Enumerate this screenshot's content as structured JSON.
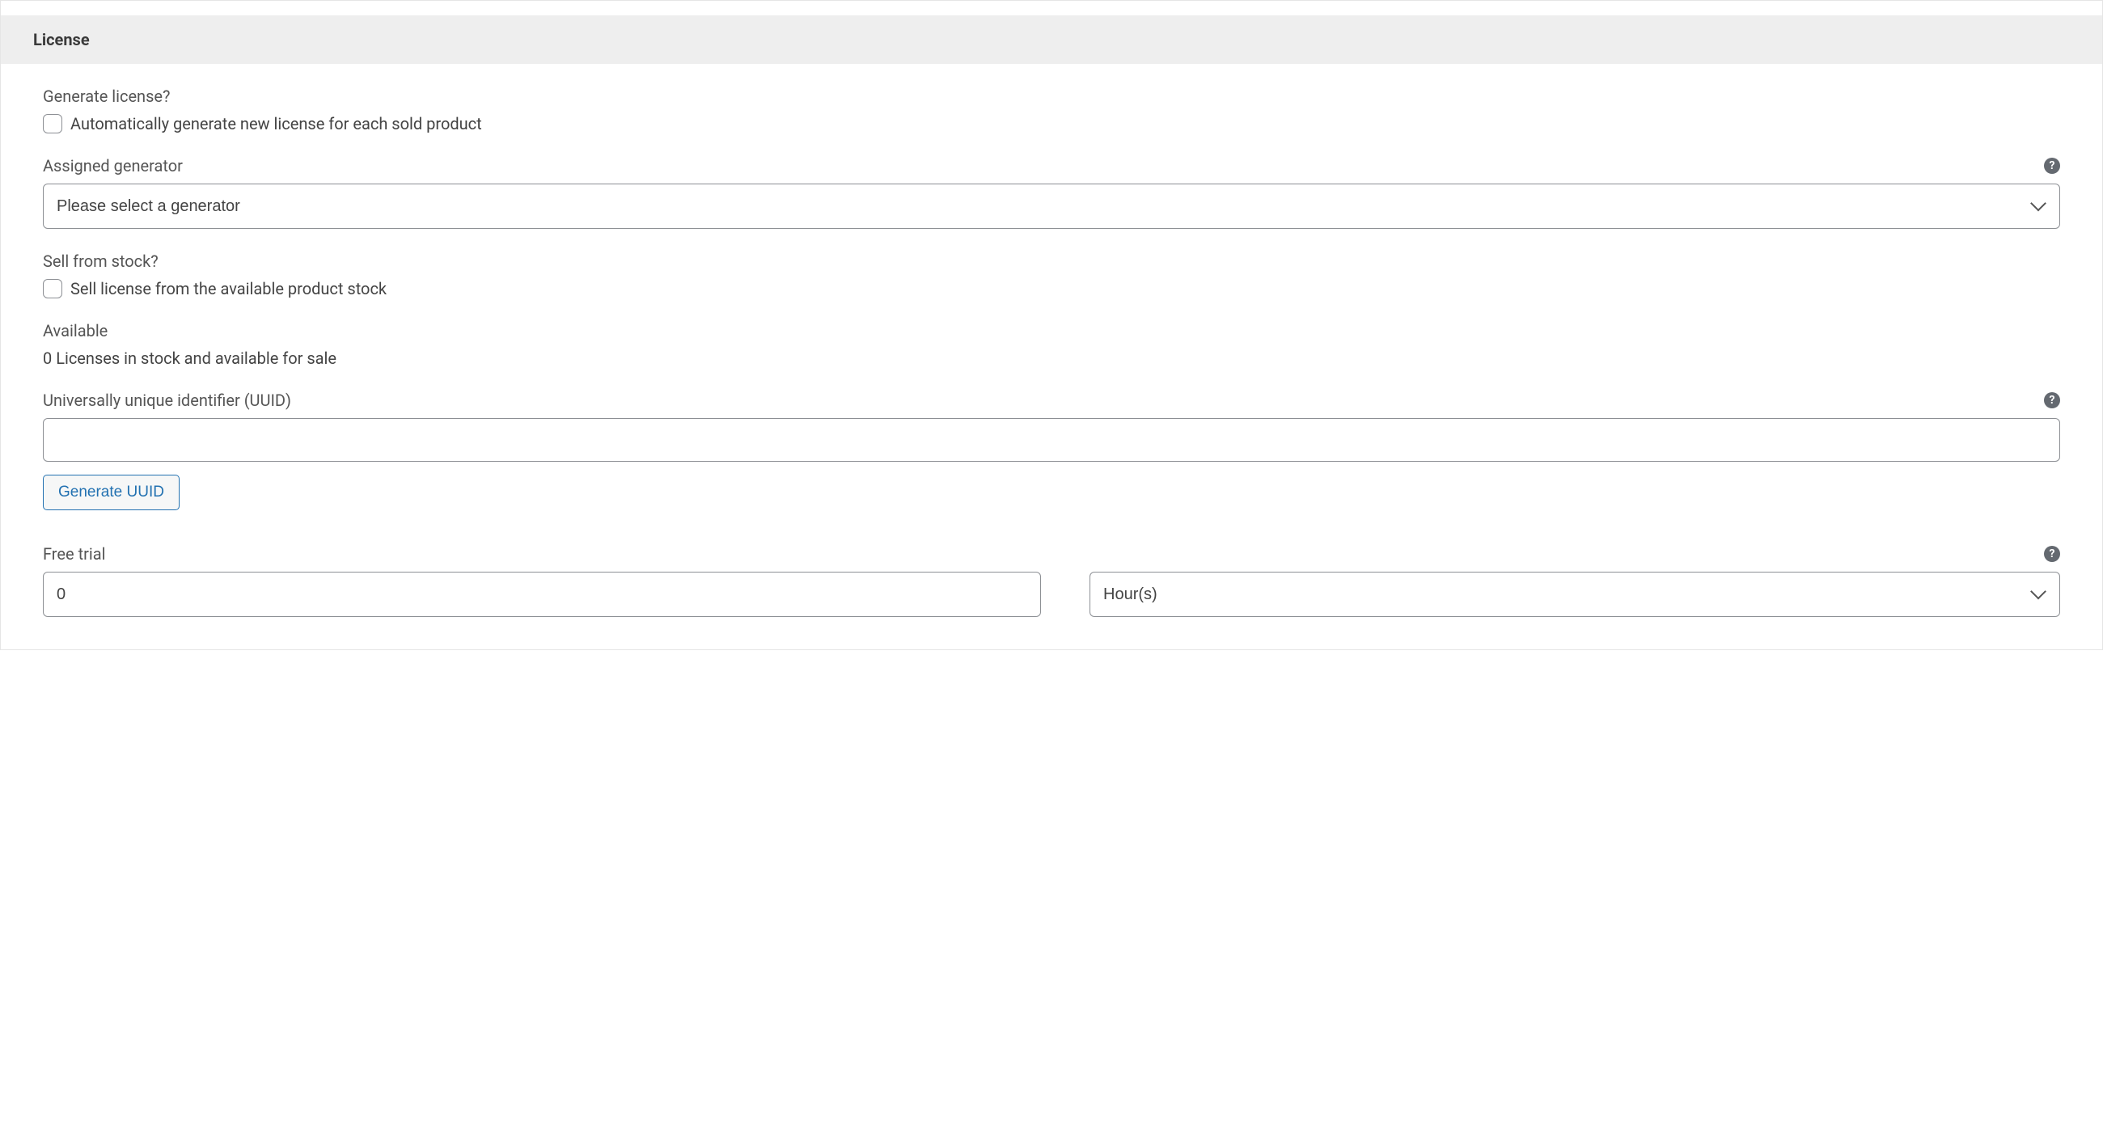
{
  "panel": {
    "title": "License"
  },
  "generate_license": {
    "label": "Generate license?",
    "checkbox_label": "Automatically generate new license for each sold product"
  },
  "assigned_generator": {
    "label": "Assigned generator",
    "selected": "Please select a generator"
  },
  "sell_from_stock": {
    "label": "Sell from stock?",
    "checkbox_label": "Sell license from the available product stock"
  },
  "available": {
    "label": "Available",
    "text": "0 Licenses in stock and available for sale"
  },
  "uuid": {
    "label": "Universally unique identifier (UUID)",
    "value": "",
    "generate_button": "Generate UUID"
  },
  "free_trial": {
    "label": "Free trial",
    "value": "0",
    "unit_selected": "Hour(s)"
  }
}
